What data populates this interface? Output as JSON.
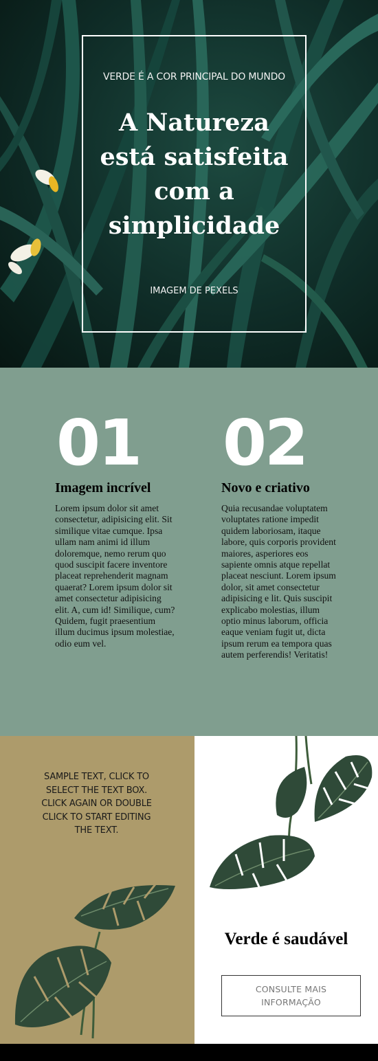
{
  "hero": {
    "kicker": "VERDE É A COR PRINCIPAL DO MUNDO",
    "title": "A Natureza está satisfeita com a simplicidade",
    "credit": "IMAGEM DE PEXELS"
  },
  "features": [
    {
      "number": "01",
      "title_bold": "Imagem",
      "title_rest": " incrível",
      "text": "Lorem ipsum dolor sit amet consectetur, adipisicing elit. Sit similique vitae cumque. Ipsa ullam nam animi id illum doloremque, nemo rerum quo quod suscipit facere inventore placeat reprehenderit magnam quaerat? Lorem ipsum dolor sit amet consectetur adipisicing elit. A, cum id! Similique, cum? Quidem, fugit praesentium illum ducimus ipsum molestiae, odio eum vel."
    },
    {
      "number": "02",
      "title_rest": "Novo e ",
      "title_bold": "criativo",
      "text": "Quia recusandae voluptatem voluptates ratione impedit quidem laboriosam, itaque labore, quis corporis provident maiores, asperiores eos sapiente omnis atque repellat placeat nesciunt. Lorem ipsum dolor, sit amet consectetur adipisicing e lit. Quis suscipit explicabo molestias, illum optio minus laborum, officia eaque veniam fugit ut, dicta ipsum rerum ea tempora quas autem perferendis! Veritatis!"
    }
  ],
  "promo": {
    "text": "SAMPLE TEXT, CLICK TO SELECT THE TEXT BOX. CLICK AGAIN OR DOUBLE CLICK TO START EDITING THE TEXT."
  },
  "cta": {
    "title_rest": "Verde é ",
    "title_bold": "saudável",
    "button_label": "CONSULTE MAIS INFORMAÇÃO"
  },
  "colors": {
    "hero_dark": "#0f2c27",
    "sage": "#809e8f",
    "khaki": "#ad9b6b",
    "leaf": "#2f4a38"
  },
  "icons": [
    "monstera-leaf-icon"
  ]
}
